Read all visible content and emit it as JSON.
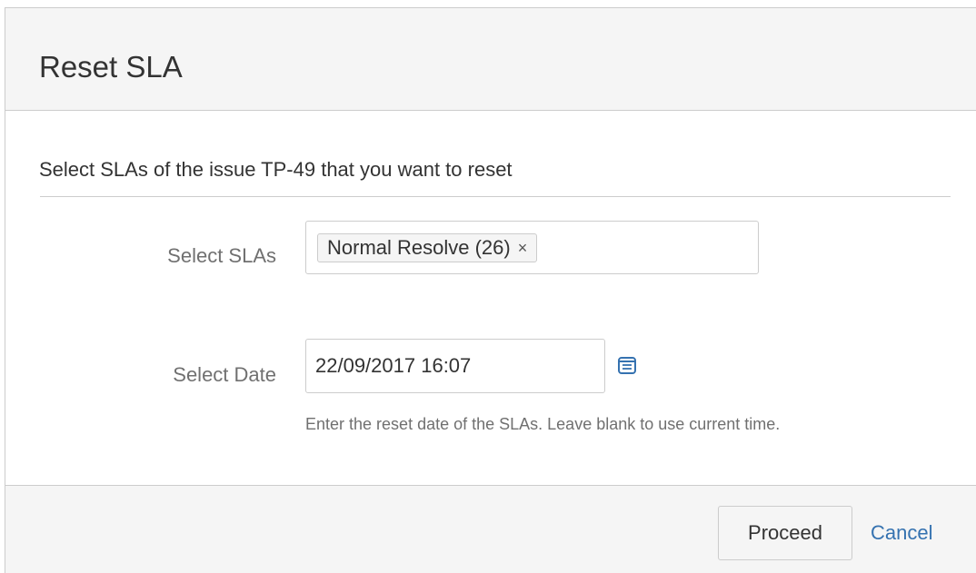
{
  "dialog": {
    "title": "Reset SLA",
    "intro": "Select SLAs of the issue TP-49 that you want to reset"
  },
  "fields": {
    "slas": {
      "label": "Select SLAs",
      "selected_token": "Normal Resolve (26)",
      "remove_glyph": "×"
    },
    "date": {
      "label": "Select Date",
      "value": "22/09/2017 16:07",
      "icon": "calendar-icon",
      "help": "Enter the reset date of the SLAs. Leave blank to use current time."
    }
  },
  "footer": {
    "proceed_label": "Proceed",
    "cancel_label": "Cancel"
  },
  "colors": {
    "link": "#3572b0",
    "calendar_icon": "#3572b0",
    "header_bg": "#f5f5f5",
    "border": "#cccccc"
  }
}
